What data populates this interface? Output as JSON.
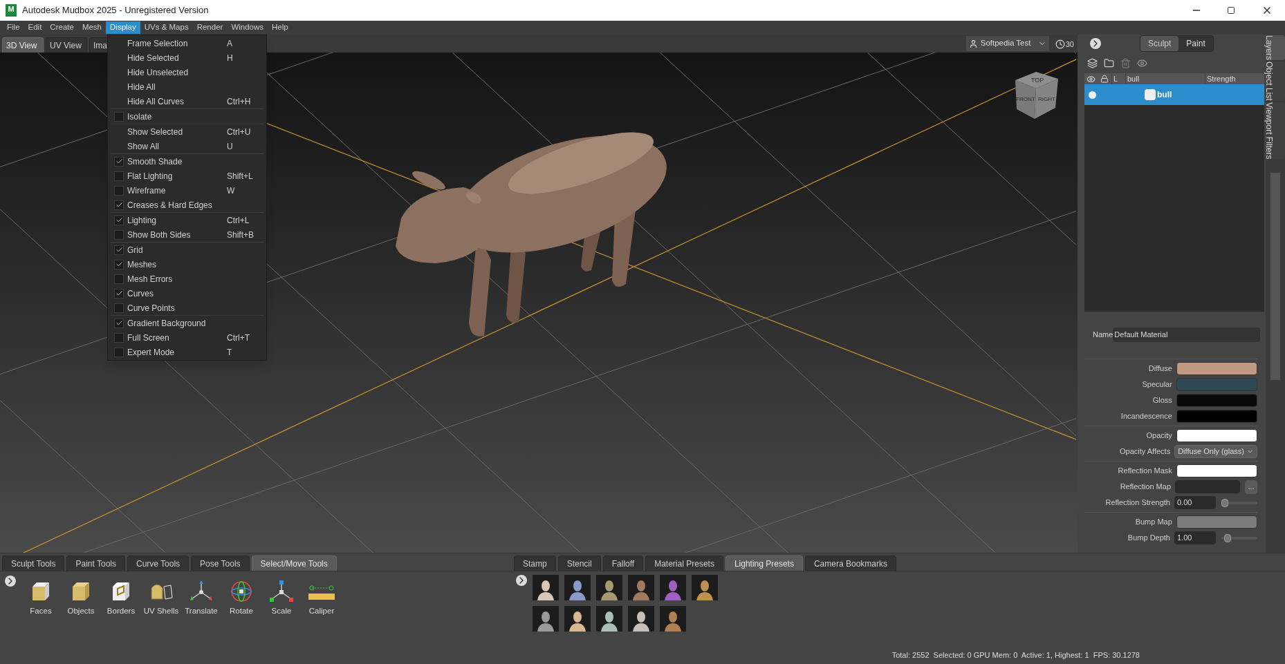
{
  "window": {
    "title": "Autodesk Mudbox 2025 - Unregistered Version",
    "logo": "M"
  },
  "menu": [
    {
      "label": "File",
      "selected": false
    },
    {
      "label": "Edit",
      "selected": false
    },
    {
      "label": "Create",
      "selected": false
    },
    {
      "label": "Mesh",
      "selected": false
    },
    {
      "label": "Display",
      "selected": true
    },
    {
      "label": "UVs & Maps",
      "selected": false
    },
    {
      "label": "Render",
      "selected": false
    },
    {
      "label": "Windows",
      "selected": false
    },
    {
      "label": "Help",
      "selected": false
    }
  ],
  "view_tabs": [
    {
      "label": "3D View",
      "selected": true
    },
    {
      "label": "UV View",
      "selected": false
    },
    {
      "label": "Ima",
      "selected": false
    }
  ],
  "user": {
    "name": "Softpedia Test"
  },
  "timer": "30",
  "view_cube": {
    "top": "TOP",
    "front": "FRONT",
    "right": "RIGHT"
  },
  "display_menu": [
    [
      {
        "kind": "plain",
        "label": "Frame Selection",
        "shortcut": "A"
      },
      {
        "kind": "plain",
        "label": "Hide Selected",
        "shortcut": "H"
      },
      {
        "kind": "plain",
        "label": "Hide Unselected"
      },
      {
        "kind": "plain",
        "label": "Hide All"
      },
      {
        "kind": "plain",
        "label": "Hide All Curves",
        "shortcut": "Ctrl+H"
      }
    ],
    [
      {
        "kind": "check",
        "label": "Isolate",
        "checked": false
      }
    ],
    [
      {
        "kind": "plain",
        "label": "Show Selected",
        "shortcut": "Ctrl+U"
      },
      {
        "kind": "plain",
        "label": "Show All",
        "shortcut": "U"
      }
    ],
    [
      {
        "kind": "check",
        "label": "Smooth Shade",
        "checked": true
      },
      {
        "kind": "check",
        "label": "Flat Lighting",
        "shortcut": "Shift+L",
        "checked": false
      },
      {
        "kind": "check",
        "label": "Wireframe",
        "shortcut": "W",
        "checked": false
      },
      {
        "kind": "check",
        "label": "Creases & Hard Edges",
        "checked": true
      }
    ],
    [
      {
        "kind": "check",
        "label": "Lighting",
        "shortcut": "Ctrl+L",
        "checked": true
      },
      {
        "kind": "check",
        "label": "Show Both Sides",
        "shortcut": "Shift+B",
        "checked": false
      }
    ],
    [
      {
        "kind": "check",
        "label": "Grid",
        "checked": true
      },
      {
        "kind": "check",
        "label": "Meshes",
        "checked": true
      },
      {
        "kind": "check",
        "label": "Mesh Errors",
        "checked": false
      },
      {
        "kind": "check",
        "label": "Curves",
        "checked": true
      },
      {
        "kind": "check",
        "label": "Curve Points",
        "checked": false
      }
    ],
    [
      {
        "kind": "check",
        "label": "Gradient Background",
        "checked": true
      },
      {
        "kind": "check",
        "label": "Full Screen",
        "shortcut": "Ctrl+T",
        "checked": false
      },
      {
        "kind": "check",
        "label": "Expert Mode",
        "shortcut": "T",
        "checked": false
      }
    ]
  ],
  "mode_tabs": [
    {
      "label": "Sculpt",
      "selected": true
    },
    {
      "label": "Paint",
      "selected": false
    }
  ],
  "layers": {
    "columns": [
      "L",
      "bull",
      "Strength"
    ],
    "rows": [
      {
        "name": "bull",
        "selected": true
      }
    ]
  },
  "side_tabs": [
    {
      "label": "Layers",
      "selected": true
    },
    {
      "label": "Object List",
      "selected": false
    },
    {
      "label": "Viewport Filters",
      "selected": false
    }
  ],
  "material": {
    "name_label": "Name",
    "name_value": "Default Material",
    "groups": [
      [
        {
          "kind": "color",
          "label": "Diffuse",
          "color": "#c09a82"
        },
        {
          "kind": "color",
          "label": "Specular",
          "color": "#2f4a55"
        },
        {
          "kind": "color",
          "label": "Gloss",
          "color": "#0a0a0a"
        },
        {
          "kind": "color",
          "label": "Incandescence",
          "color": "#000000"
        }
      ],
      [
        {
          "kind": "color",
          "label": "Opacity",
          "color": "#ffffff"
        },
        {
          "kind": "select",
          "label": "Opacity Affects",
          "value": "Diffuse Only (glass)"
        }
      ],
      [
        {
          "kind": "color",
          "label": "Reflection Mask",
          "color": "#ffffff"
        },
        {
          "kind": "map",
          "label": "Reflection Map",
          "button": "..."
        },
        {
          "kind": "slider",
          "label": "Reflection Strength",
          "value": "0.00",
          "level": 0
        }
      ],
      [
        {
          "kind": "color",
          "label": "Bump Map",
          "color": "#7b7b7b"
        },
        {
          "kind": "slider",
          "label": "Bump Depth",
          "value": "1.00",
          "level": 0.1
        }
      ]
    ]
  },
  "tool_tabs": [
    {
      "label": "Sculpt Tools",
      "selected": false
    },
    {
      "label": "Paint Tools",
      "selected": false
    },
    {
      "label": "Curve Tools",
      "selected": false
    },
    {
      "label": "Pose Tools",
      "selected": false
    },
    {
      "label": "Select/Move Tools",
      "selected": true
    }
  ],
  "tools": [
    {
      "kind": "faces",
      "label": "Faces"
    },
    {
      "kind": "objects",
      "label": "Objects"
    },
    {
      "kind": "borders",
      "label": "Borders"
    },
    {
      "kind": "uvshells",
      "label": "UV Shells"
    },
    {
      "kind": "translate",
      "label": "Translate"
    },
    {
      "kind": "rotate",
      "label": "Rotate"
    },
    {
      "kind": "scale",
      "label": "Scale"
    },
    {
      "kind": "caliper",
      "label": "Caliper"
    }
  ],
  "preset_tabs": [
    {
      "label": "Stamp",
      "selected": false
    },
    {
      "label": "Stencil",
      "selected": false
    },
    {
      "label": "Falloff",
      "selected": false
    },
    {
      "label": "Material Presets",
      "selected": false
    },
    {
      "label": "Lighting Presets",
      "selected": true
    },
    {
      "label": "Camera Bookmarks",
      "selected": false
    }
  ],
  "lighting_presets": [
    [
      {
        "color": "#d8c7b8"
      },
      {
        "color": "#8a9ac8"
      },
      {
        "color": "#a89a70"
      },
      {
        "color": "#a07a60"
      },
      {
        "color": "#a060c0"
      },
      {
        "color": "#c09050"
      }
    ],
    [
      {
        "color": "#9a9a9a"
      },
      {
        "color": "#d8b890"
      },
      {
        "color": "#a8c0b8"
      },
      {
        "color": "#c8c0b8"
      },
      {
        "color": "#b08050"
      }
    ]
  ],
  "status": "Total: 2552  Selected: 0 GPU Mem: 0  Active: 1, Highest: 1  FPS: 30.1278"
}
